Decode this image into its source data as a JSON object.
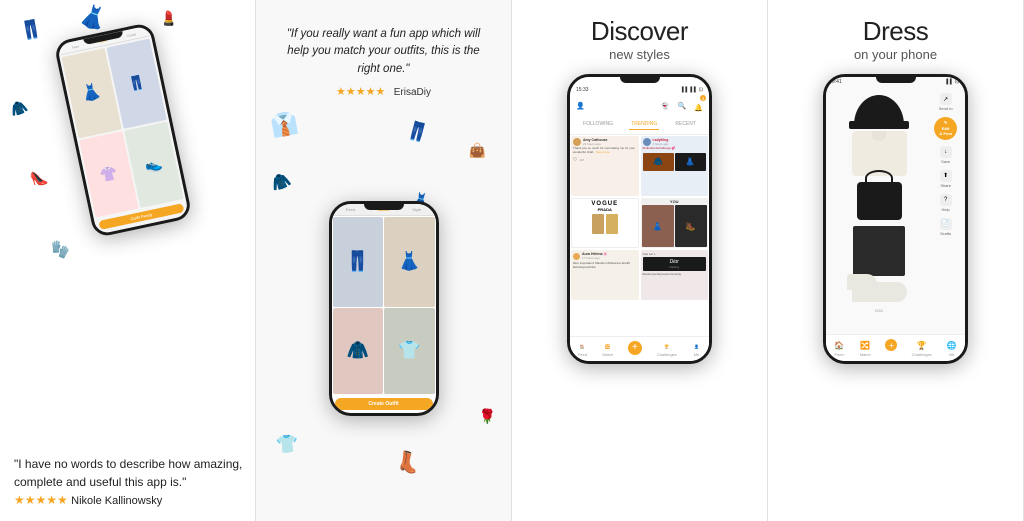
{
  "panel1": {
    "quote": "\"I have no words to describe how amazing, complete and useful this app is.\"",
    "author": "Nikole Kallinowsky",
    "stars": "★★★★★"
  },
  "panel2": {
    "quote": "\"If you really want a fun app which will help you match your outfits, this is the right one.\"",
    "stars": "★★★★★",
    "author": "ErisaDiy"
  },
  "panel3": {
    "heading": "Discover",
    "subheading": "new styles",
    "feed": {
      "statusTime": "15:33",
      "tabs": [
        "FOLLOWING",
        "TRENDING",
        "RECENT"
      ],
      "activeTab": "TRENDING",
      "bottomItems": [
        "Feed",
        "Match",
        "Create",
        "Challenges",
        "Me"
      ]
    }
  },
  "panel4": {
    "heading": "Dress",
    "subheading": "on your phone",
    "sideButtons": [
      "Send to",
      "Edit & Post",
      "Save",
      "Share",
      "Help",
      "Drafts"
    ],
    "bottomItems": [
      "Feed",
      "Match",
      "Create",
      "Challenges",
      "Me"
    ]
  }
}
